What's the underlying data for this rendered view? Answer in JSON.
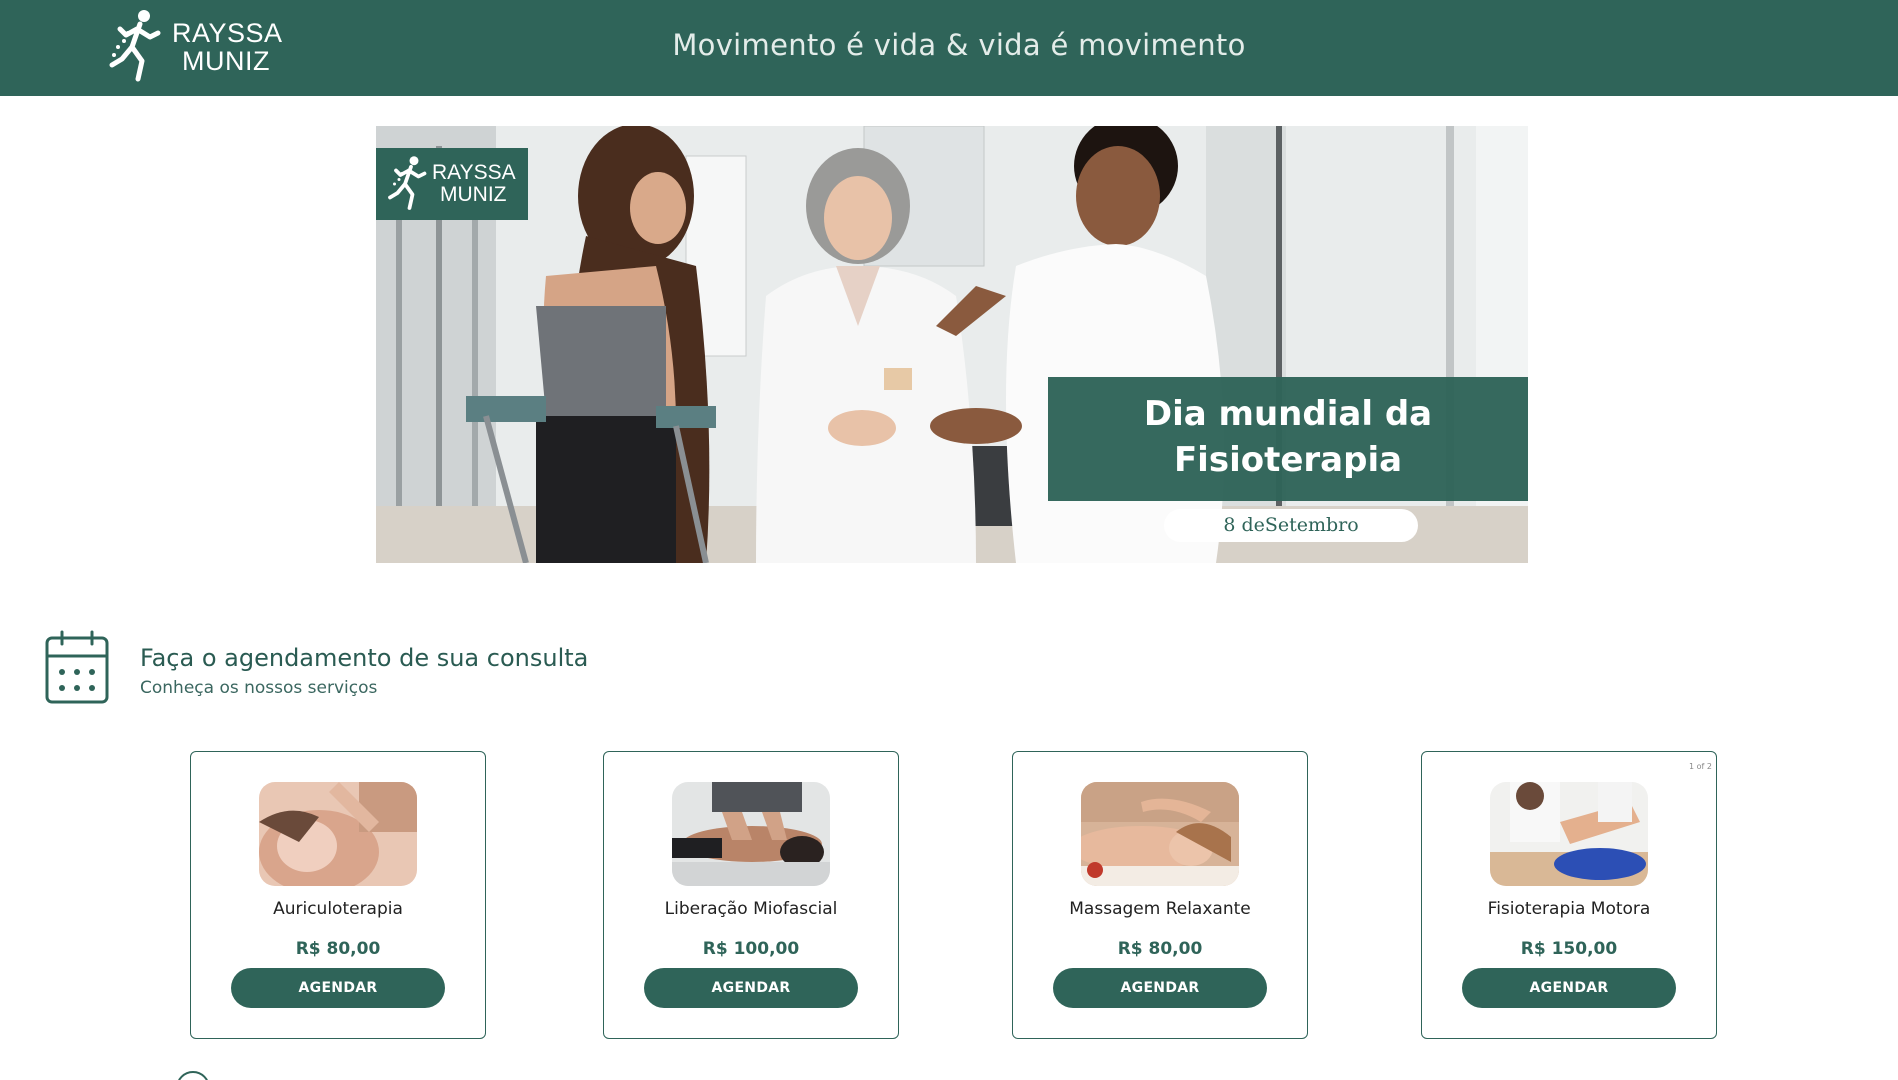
{
  "header": {
    "logo_line1": "RAYSSA",
    "logo_line2": "MUNIZ",
    "tagline": "Movimento é vida & vida é movimento"
  },
  "banner": {
    "logo_line1": "RAYSSA",
    "logo_line2": "MUNIZ",
    "title_line1": "Dia mundial da",
    "title_line2": "Fisioterapia",
    "date": "8 deSetembro"
  },
  "schedule": {
    "title": "Faça o agendamento de sua consulta",
    "subtitle": "Conheça os nossos serviços"
  },
  "services": [
    {
      "name": "Auriculoterapia",
      "price": "R$ 80,00",
      "button": "AGENDAR"
    },
    {
      "name": "Liberação Miofascial",
      "price": "R$ 100,00",
      "button": "AGENDAR"
    },
    {
      "name": "Massagem Relaxante",
      "price": "R$ 80,00",
      "button": "AGENDAR"
    },
    {
      "name": "Fisioterapia Motora",
      "price": "R$ 150,00",
      "button": "AGENDAR"
    }
  ],
  "carousel": {
    "pager": "1 of 2"
  },
  "colors": {
    "brand": "#2f6459",
    "white": "#ffffff"
  }
}
